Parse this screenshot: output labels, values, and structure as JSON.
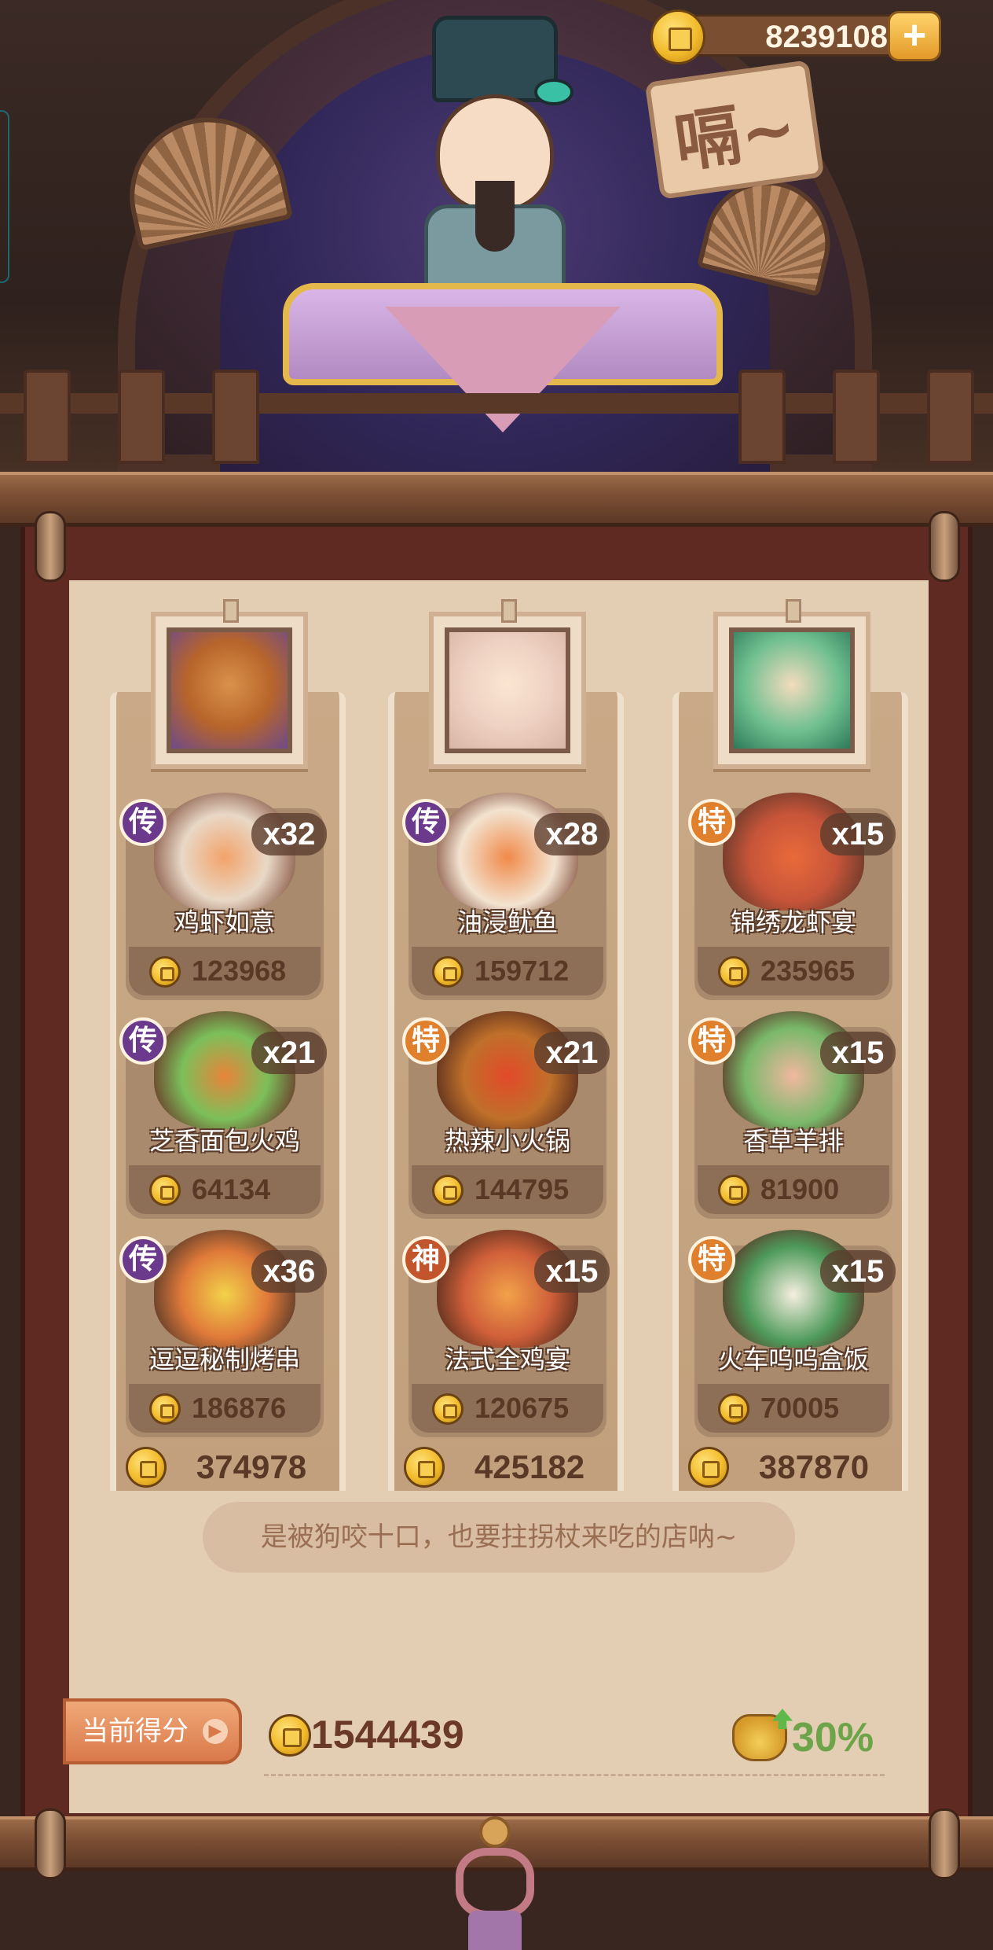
{
  "currency": {
    "amount": "8239108",
    "add_label": "+"
  },
  "sign_text": "嗝~",
  "restaurants": [
    {
      "portrait": "bear-chef-portrait",
      "dishes": [
        {
          "rank": "传",
          "name": "鸡虾如意",
          "count": "x32",
          "price": "123968",
          "art": "a1"
        },
        {
          "rank": "传",
          "name": "芝香面包火鸡",
          "count": "x21",
          "price": "64134",
          "art": "a4"
        },
        {
          "rank": "传",
          "name": "逗逗秘制烤串",
          "count": "x36",
          "price": "186876",
          "art": "a7"
        }
      ],
      "total": "374978"
    },
    {
      "portrait": "white-hood-girl-portrait",
      "dishes": [
        {
          "rank": "传",
          "name": "油浸鱿鱼",
          "count": "x28",
          "price": "159712",
          "art": "a2"
        },
        {
          "rank": "特",
          "name": "热辣小火锅",
          "count": "x21",
          "price": "144795",
          "art": "a5"
        },
        {
          "rank": "神",
          "name": "法式全鸡宴",
          "count": "x15",
          "price": "120675",
          "art": "a8"
        }
      ],
      "total": "425182"
    },
    {
      "portrait": "jade-crown-girl-portrait",
      "dishes": [
        {
          "rank": "特",
          "name": "锦绣龙虾宴",
          "count": "x15",
          "price": "235965",
          "art": "a3"
        },
        {
          "rank": "特",
          "name": "香草羊排",
          "count": "x15",
          "price": "81900",
          "art": "a6"
        },
        {
          "rank": "特",
          "name": "火车呜呜盒饭",
          "count": "x15",
          "price": "70005",
          "art": "a9"
        }
      ],
      "total": "387870"
    }
  ],
  "quote": "是被狗咬十口，也要拄拐杖来吃的店呐~",
  "score": {
    "label": "当前得分",
    "arrow": "▶",
    "value": "1544439",
    "bonus_percent": "30%",
    "bonus_icon": "full-bag-icon"
  },
  "colors": {
    "rank_chuan": "#6b3a8c",
    "rank_te": "#e07f2c",
    "rank_shen": "#c2552c",
    "bonus_green": "#6da44a"
  }
}
